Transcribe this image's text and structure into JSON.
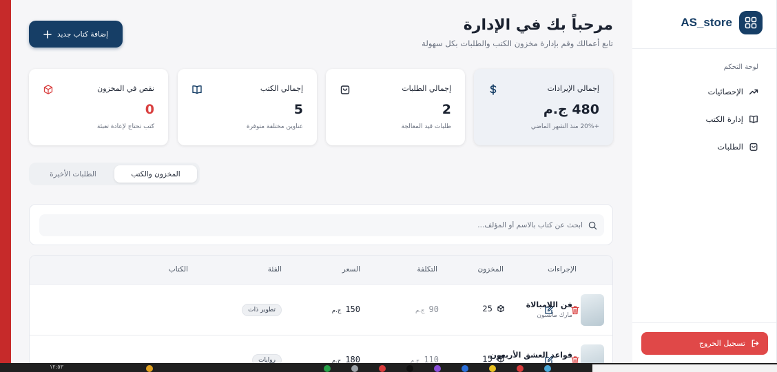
{
  "sidebar": {
    "brand": "AS_store",
    "section_label": "لوحة التحكم",
    "items": [
      {
        "label": "الإحصائيات",
        "icon": "trend-up-icon"
      },
      {
        "label": "إدارة الكتب",
        "icon": "book-open-icon"
      },
      {
        "label": "الطلبات",
        "icon": "shopping-bag-icon"
      }
    ],
    "logout_label": "تسجيل الخروج"
  },
  "header": {
    "title": "مرحباً بك في الإدارة",
    "subtitle": "تابع أعمالك وقم بإدارة مخزون الكتب والطلبات بكل سهولة",
    "add_button": "إضافة كتاب جديد"
  },
  "stats": [
    {
      "label": "إجمالي الإيرادات",
      "value": "480 ج.م",
      "note": "+20% منذ الشهر الماضي",
      "icon": "dollar-icon"
    },
    {
      "label": "إجمالي الطلبات",
      "value": "2",
      "note": "طلبات قيد المعالجة",
      "icon": "shopping-bag-icon"
    },
    {
      "label": "إجمالي الكتب",
      "value": "5",
      "note": "عناوين مختلفة متوفرة",
      "icon": "book-open-icon"
    },
    {
      "label": "نقص في المخزون",
      "value": "0",
      "note": "كتب تحتاج لإعادة تعبئة",
      "icon": "package-icon"
    }
  ],
  "tabs": [
    {
      "label": "المخزون والكتب",
      "active": true
    },
    {
      "label": "الطلبات الأخيرة",
      "active": false
    }
  ],
  "search": {
    "placeholder": "ابحث عن كتاب بالاسم أو المؤلف...",
    "value": ""
  },
  "table": {
    "headers": {
      "book": "الكتاب",
      "category": "الفئة",
      "price": "السعر",
      "cost": "التكلفة",
      "stock": "المخزون",
      "actions": "الإجراءات"
    },
    "rows": [
      {
        "title": "فن اللامبالاة",
        "author": "مارك مانسون",
        "category": "تطوير ذات",
        "price": "150",
        "price_currency": "ج.م",
        "cost": "90",
        "cost_currency": "ج.م",
        "stock": "25"
      },
      {
        "title": "قواعد العشق الأربعون",
        "author": "",
        "category": "روايات",
        "price": "180",
        "price_currency": "ج.م",
        "cost": "110",
        "cost_currency": "ج.م",
        "stock": "15"
      }
    ]
  },
  "taskbar": {
    "clock": "١٢:٥٣"
  },
  "colors": {
    "primary": "#163e66",
    "danger": "#e04848",
    "frame": "#c62a2a",
    "background": "#f6f6f8"
  }
}
